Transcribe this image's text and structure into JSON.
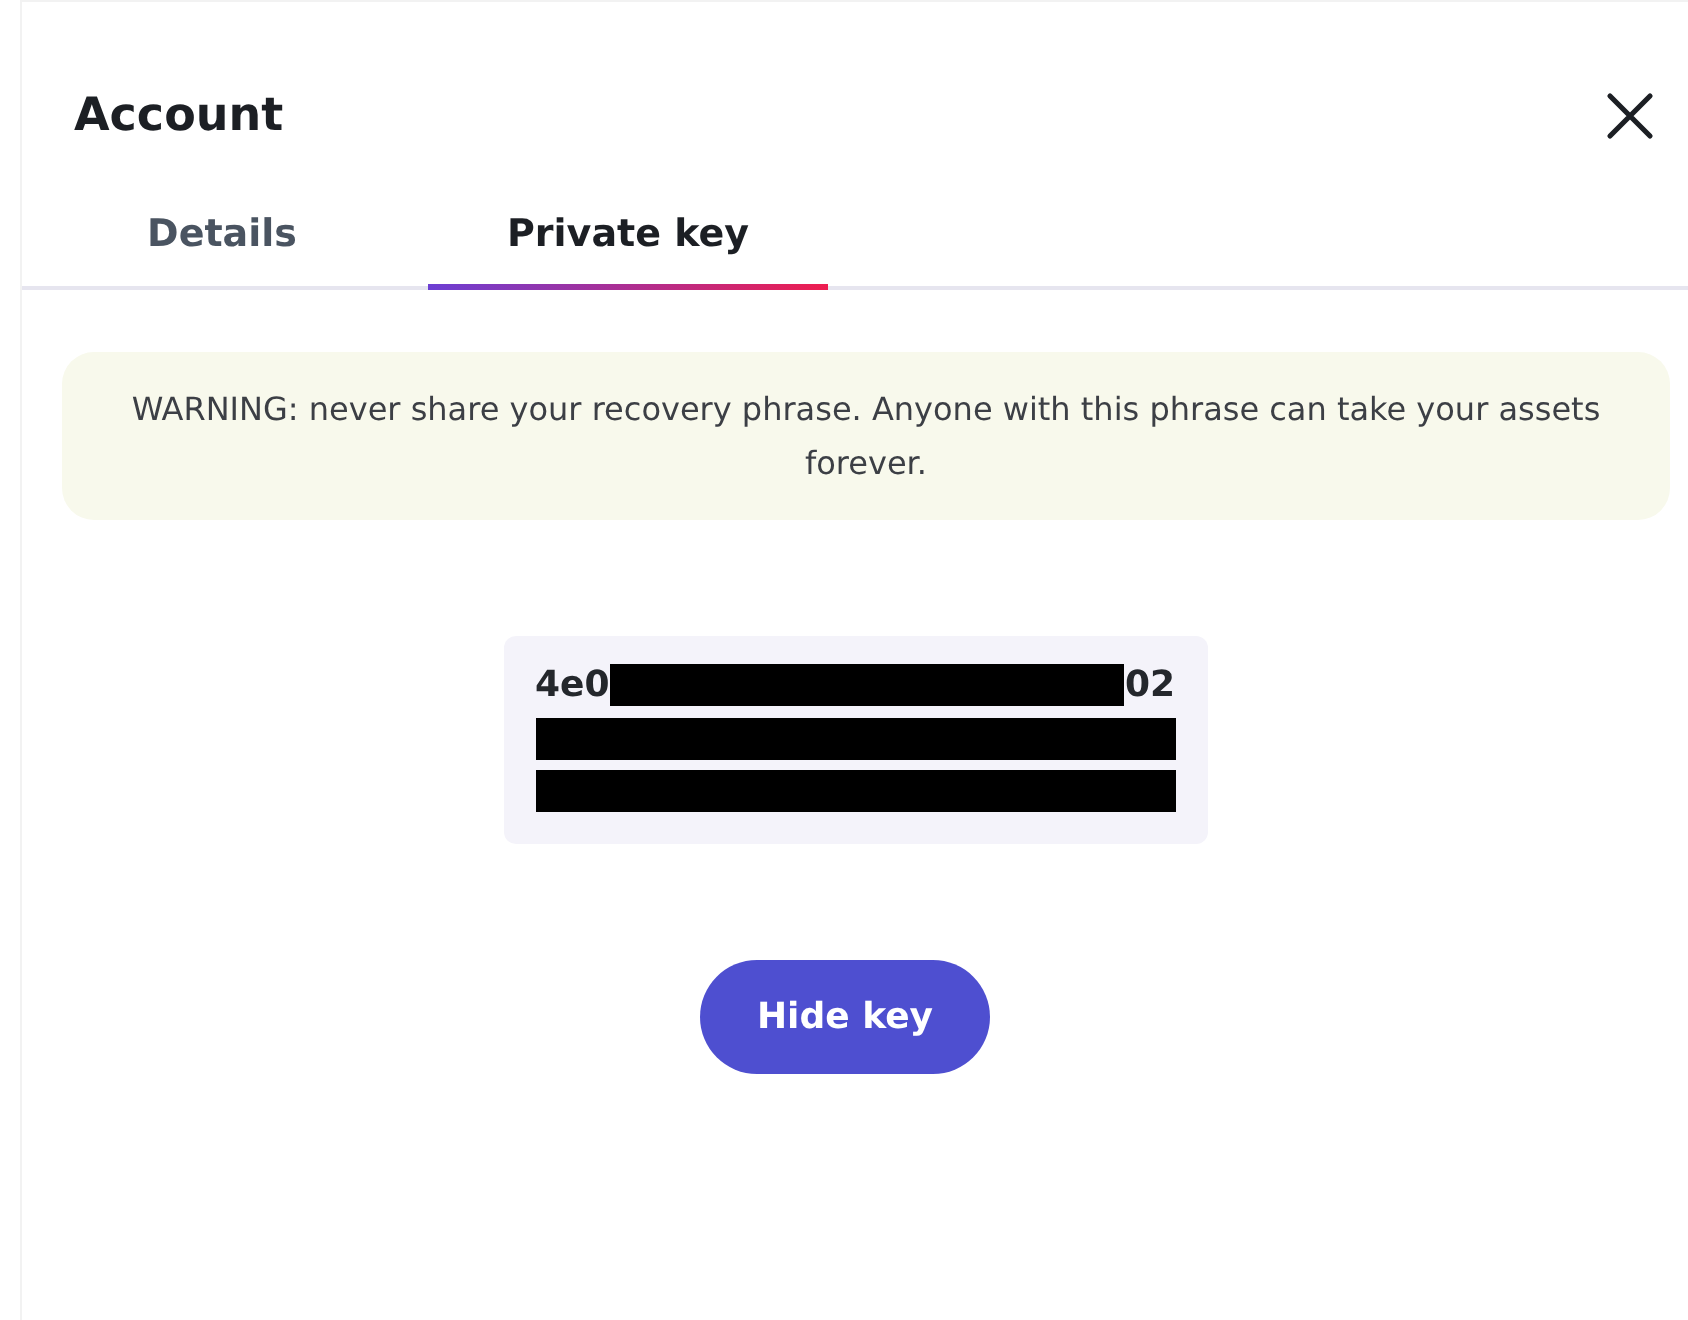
{
  "title": "Account",
  "tabs": [
    {
      "label": "Details",
      "selected": false
    },
    {
      "label": "Private key",
      "selected": true
    }
  ],
  "warning": "WARNING: never share your recovery phrase. Anyone with this phrase can take your assets forever.",
  "key": {
    "start": "4e0",
    "end": "02"
  },
  "button": "Hide key"
}
